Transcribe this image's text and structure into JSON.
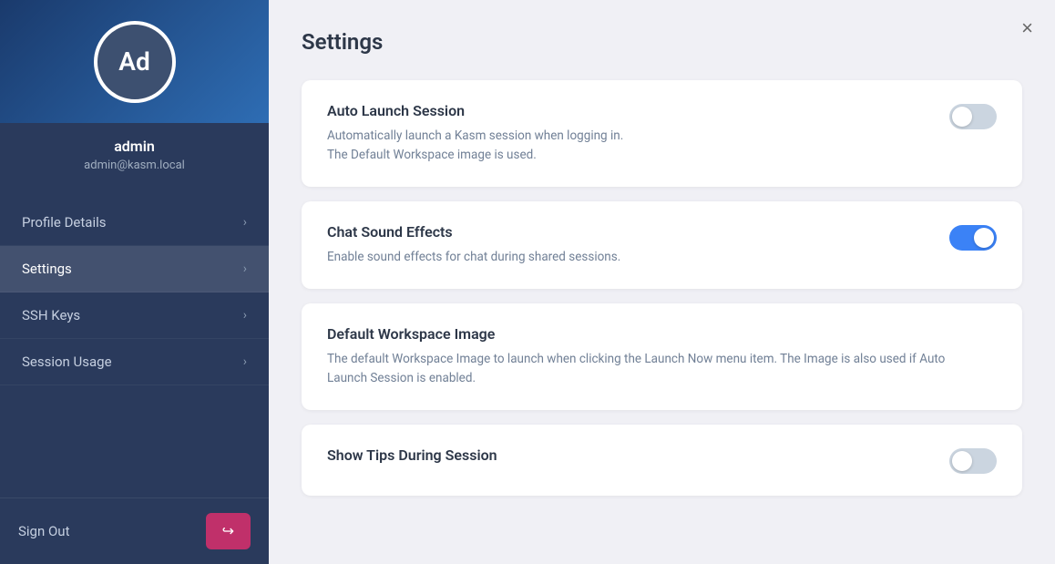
{
  "sidebar": {
    "avatar_initials": "Ad",
    "username": "admin",
    "email": "admin@kasm.local",
    "nav_items": [
      {
        "id": "profile-details",
        "label": "Profile Details",
        "active": false
      },
      {
        "id": "settings",
        "label": "Settings",
        "active": true
      },
      {
        "id": "ssh-keys",
        "label": "SSH Keys",
        "active": false
      },
      {
        "id": "session-usage",
        "label": "Session Usage",
        "active": false
      }
    ],
    "sign_out_label": "Sign Out"
  },
  "main": {
    "page_title": "Settings",
    "close_icon": "×",
    "cards": [
      {
        "id": "auto-launch-session",
        "title": "Auto Launch Session",
        "description": "Automatically launch a Kasm session when logging in.\nThe Default Workspace image is used.",
        "toggle_on": false
      },
      {
        "id": "chat-sound-effects",
        "title": "Chat Sound Effects",
        "description": "Enable sound effects for chat during shared sessions.",
        "toggle_on": true
      },
      {
        "id": "default-workspace-image",
        "title": "Default Workspace Image",
        "description": "The default Workspace Image to launch when clicking the Launch Now menu item. The Image is also used if Auto Launch Session is enabled.",
        "toggle_on": null
      },
      {
        "id": "show-tips-during-session",
        "title": "Show Tips During Session",
        "description": "",
        "toggle_on": false
      }
    ]
  }
}
